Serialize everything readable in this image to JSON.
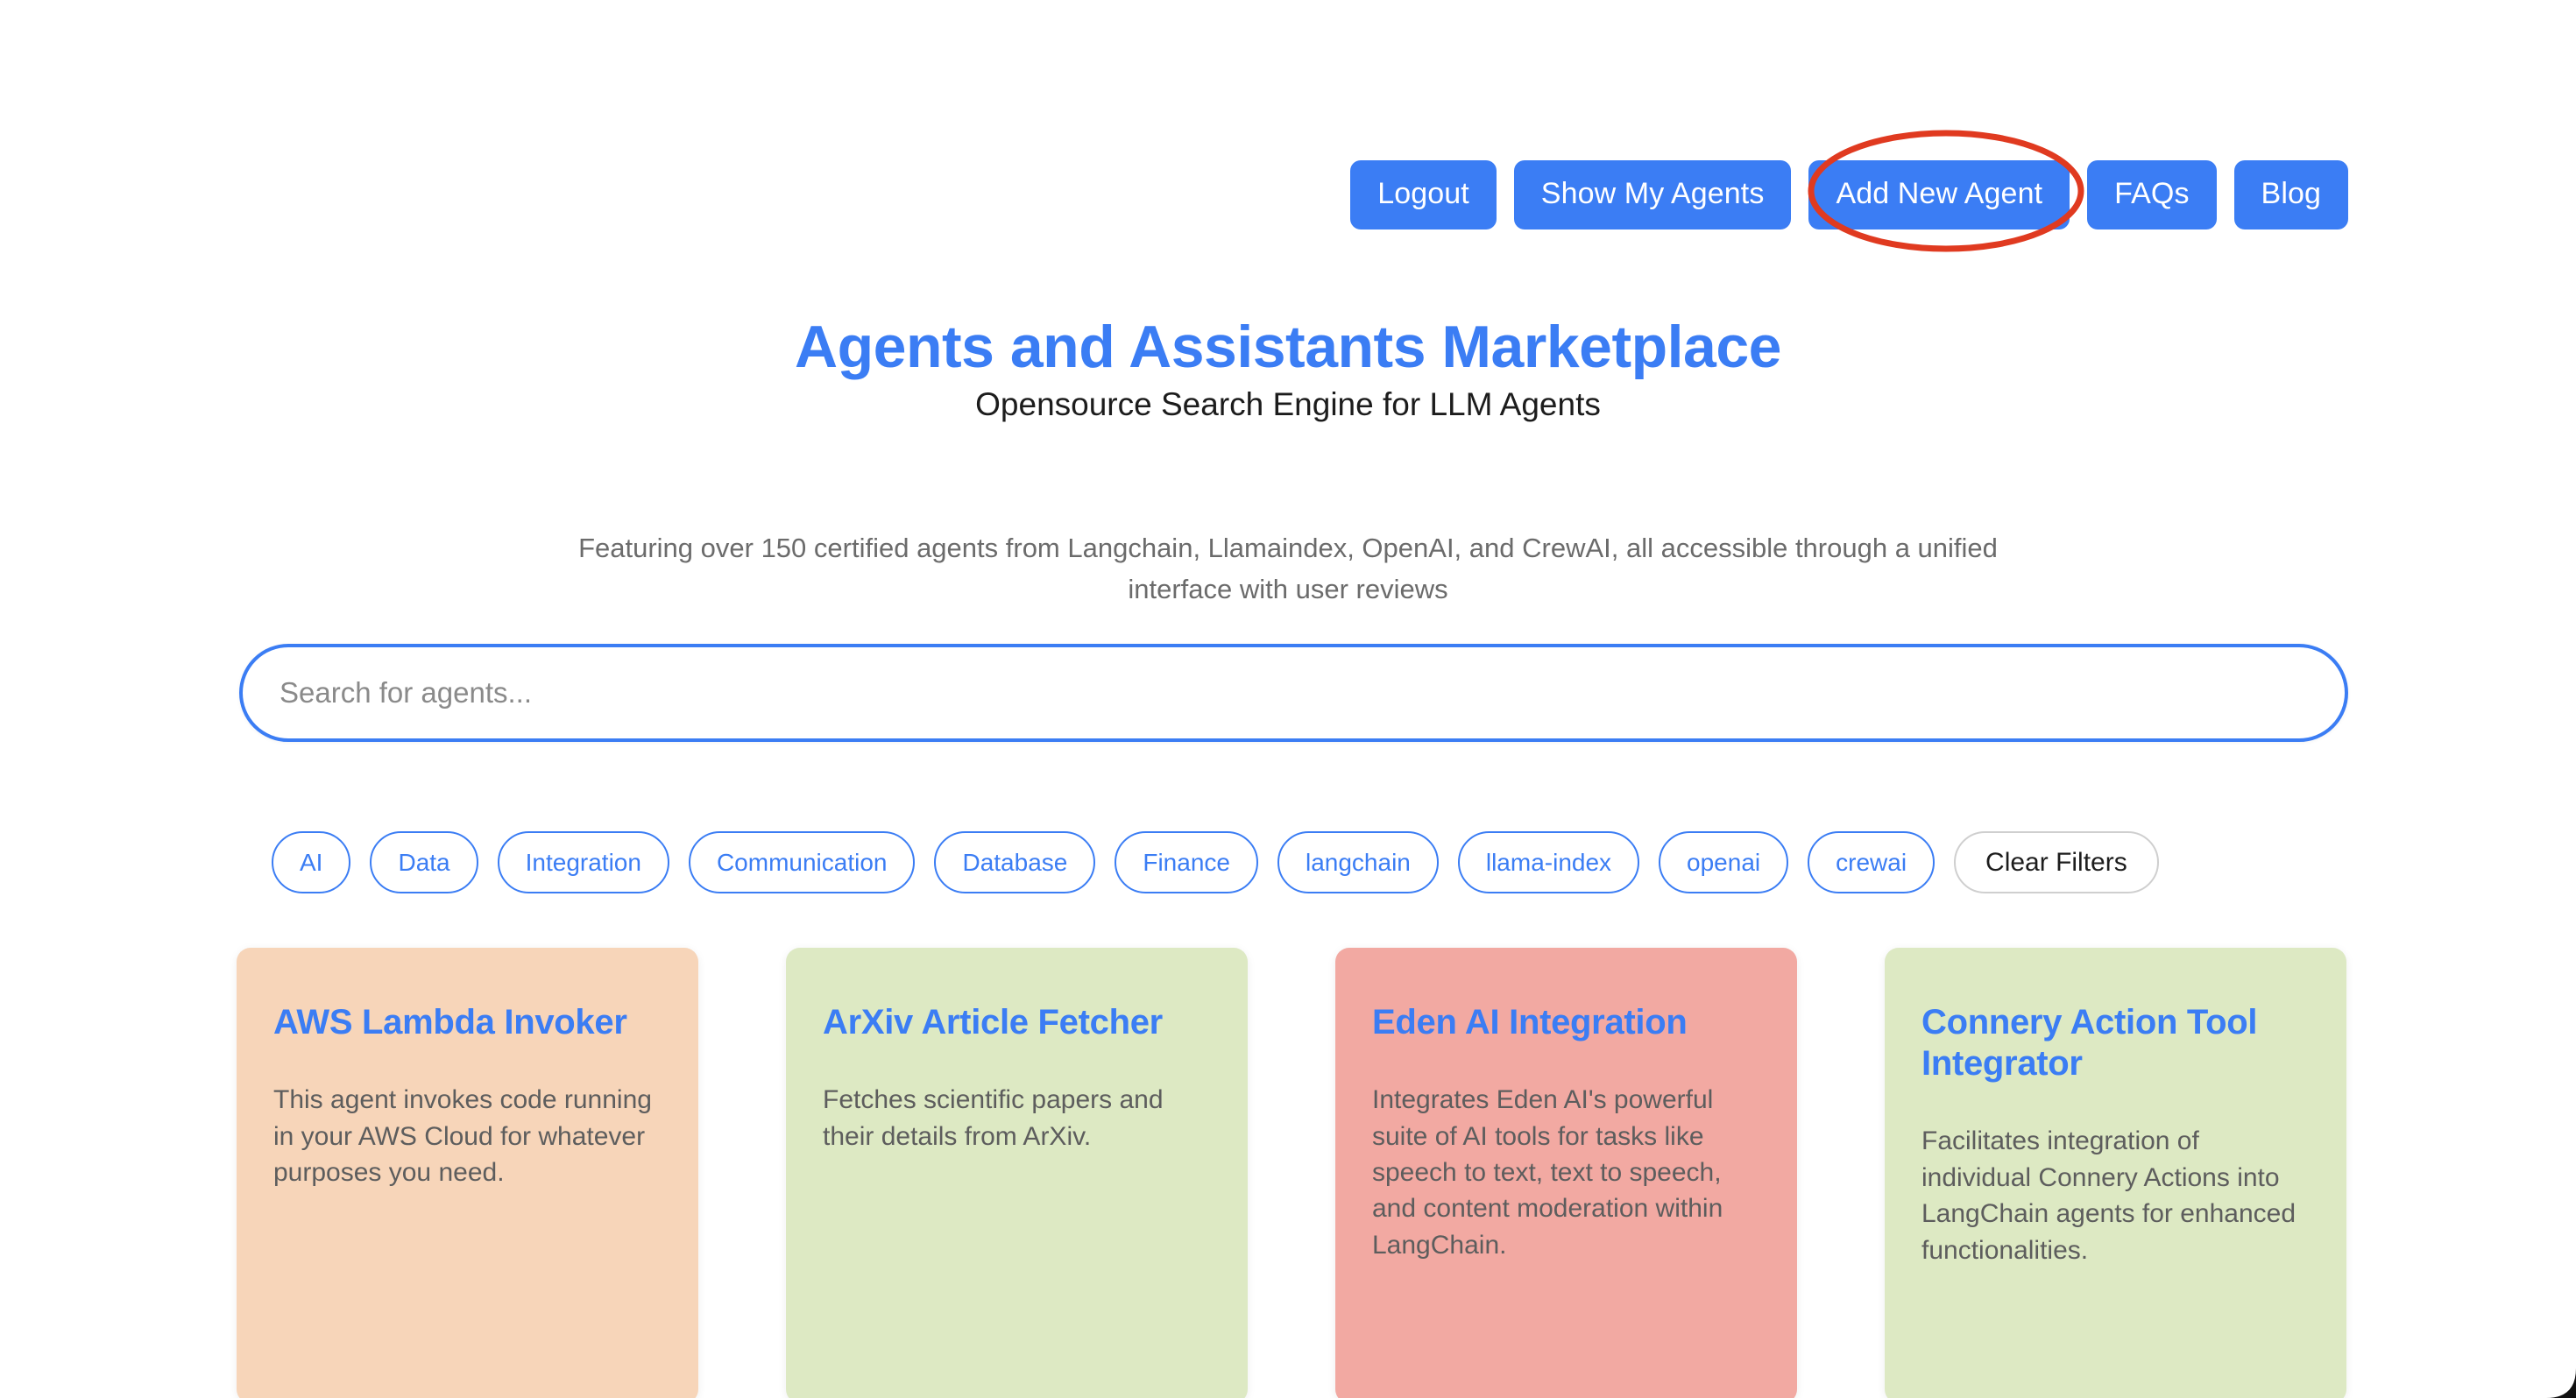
{
  "theme": {
    "accent_blue": "#3b7df4",
    "annotation_red": "#e03a20",
    "text_dark": "#1c1c1c",
    "text_muted": "#6b6b6b",
    "card_text": "#5d5d5d",
    "clear_border": "#cfcfcf"
  },
  "nav": {
    "buttons": [
      {
        "label": "Logout",
        "name": "logout-button"
      },
      {
        "label": "Show My Agents",
        "name": "show-my-agents-button"
      },
      {
        "label": "Add New Agent",
        "name": "add-new-agent-button"
      },
      {
        "label": "FAQs",
        "name": "faqs-button"
      },
      {
        "label": "Blog",
        "name": "blog-button"
      }
    ]
  },
  "annotation": {
    "shape": "ellipse",
    "color": "#e03a20",
    "targets": "Add New Agent"
  },
  "hero": {
    "title": "Agents and Assistants Marketplace",
    "subtitle": "Opensource Search Engine for LLM Agents",
    "description": "Featuring over 150 certified agents from Langchain, Llamaindex, OpenAI, and CrewAI, all accessible through a unified interface with user reviews"
  },
  "search": {
    "placeholder": "Search for agents...",
    "value": ""
  },
  "filters": {
    "chips": [
      "AI",
      "Data",
      "Integration",
      "Communication",
      "Database",
      "Finance",
      "langchain",
      "llama-index",
      "openai",
      "crewai"
    ],
    "clear_label": "Clear Filters"
  },
  "cards": [
    {
      "title": "AWS Lambda Invoker",
      "description": "This agent invokes code running in your AWS Cloud for whatever purposes you need.",
      "bg": "#f7d5b9"
    },
    {
      "title": "ArXiv Article Fetcher",
      "description": "Fetches scientific papers and their details from ArXiv.",
      "bg": "#dde9c3"
    },
    {
      "title": "Eden AI Integration",
      "description": "Integrates Eden AI's powerful suite of AI tools for tasks like speech to text, text to speech, and content moderation within LangChain.",
      "bg": "#f2a9a2"
    },
    {
      "title": "Connery Action Tool Integrator",
      "description": "Facilitates integration of individual Connery Actions into LangChain agents for enhanced functionalities.",
      "bg": "#dde9c3"
    }
  ]
}
